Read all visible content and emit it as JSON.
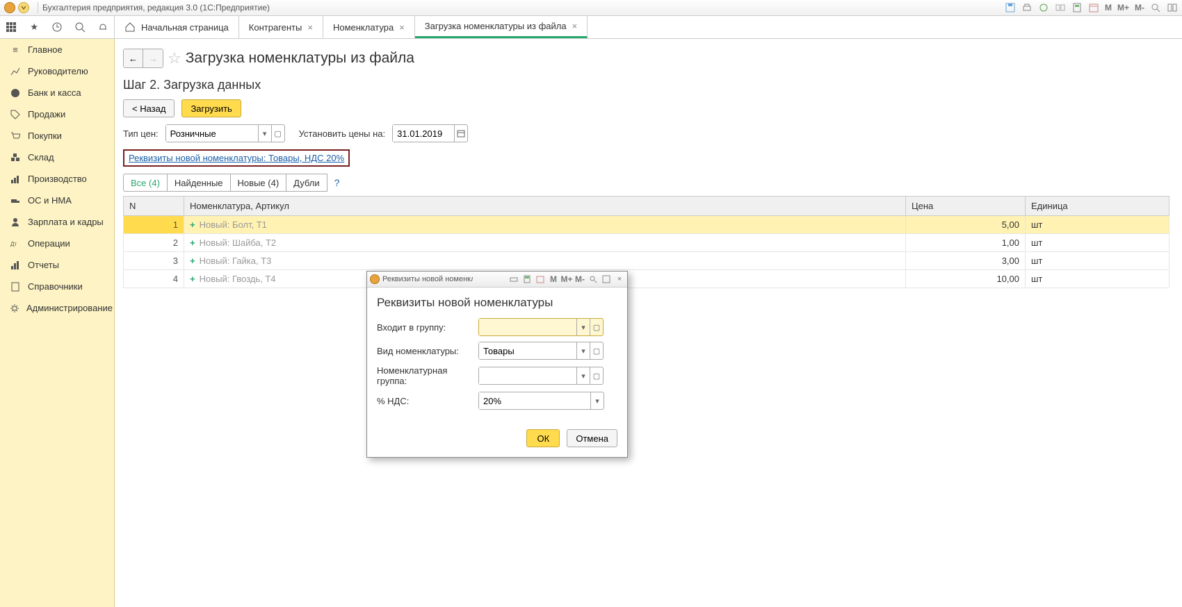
{
  "app": {
    "title": "Бухгалтерия предприятия, редакция 3.0  (1С:Предприятие)",
    "right_icons": [
      "M",
      "M+",
      "M-"
    ]
  },
  "topTabs": {
    "home": "Начальная страница",
    "items": [
      "Контрагенты",
      "Номенклатура",
      "Загрузка номенклатуры из файла"
    ],
    "active_index": 2
  },
  "sidebar": {
    "items": [
      "Главное",
      "Руководителю",
      "Банк и касса",
      "Продажи",
      "Покупки",
      "Склад",
      "Производство",
      "ОС и НМА",
      "Зарплата и кадры",
      "Операции",
      "Отчеты",
      "Справочники",
      "Администрирование"
    ]
  },
  "page": {
    "title": "Загрузка номенклатуры из файла",
    "subtitle": "Шаг 2. Загрузка данных",
    "back_btn": "< Назад",
    "load_btn": "Загрузить",
    "price_type_label": "Тип цен:",
    "price_type_value": "Розничные",
    "set_prices_label": "Установить цены на:",
    "set_prices_date": "31.01.2019",
    "requisites_link": "Реквизиты новой номенклатуры: Товары, НДС 20%",
    "filter_tabs": [
      "Все (4)",
      "Найденные",
      "Новые (4)",
      "Дубли"
    ],
    "question": "?"
  },
  "table": {
    "headers": {
      "n": "N",
      "nom": "Номенклатура, Артикул",
      "price": "Цена",
      "unit": "Единица"
    },
    "rows": [
      {
        "n": "1",
        "status": "Новый",
        "name": "Болт, Т1",
        "price": "5,00",
        "unit": "шт"
      },
      {
        "n": "2",
        "status": "Новый",
        "name": "Шайба, Т2",
        "price": "1,00",
        "unit": "шт"
      },
      {
        "n": "3",
        "status": "Новый",
        "name": "Гайка, Т3",
        "price": "3,00",
        "unit": "шт"
      },
      {
        "n": "4",
        "status": "Новый",
        "name": "Гвоздь, Т4",
        "price": "10,00",
        "unit": "шт"
      }
    ]
  },
  "dialog": {
    "titlebar": "Реквизиты новой номенклат...",
    "heading": "Реквизиты новой номенклатуры",
    "icons": [
      "M",
      "M+",
      "M-"
    ],
    "fields": {
      "group_label": "Входит в группу:",
      "group_value": "",
      "type_label": "Вид номенклатуры:",
      "type_value": "Товары",
      "nomgroup_label": "Номенклатурная группа:",
      "nomgroup_value": "",
      "vat_label": "% НДС:",
      "vat_value": "20%"
    },
    "ok": "ОК",
    "cancel": "Отмена"
  }
}
